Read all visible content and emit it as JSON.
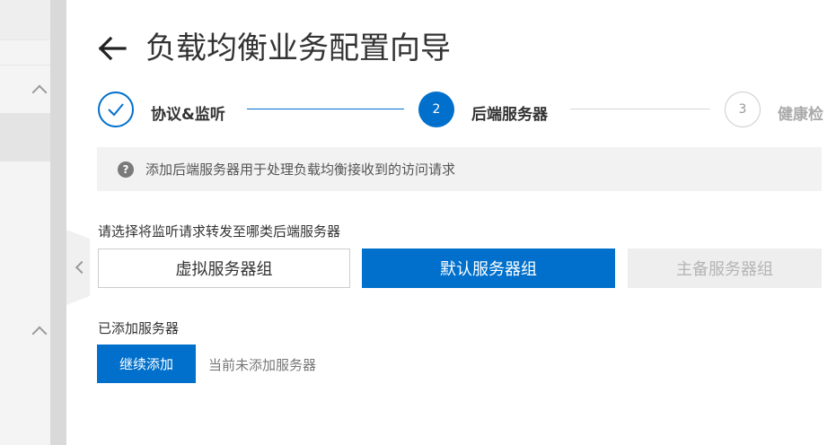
{
  "header": {
    "title": "负载均衡业务配置向导"
  },
  "stepper": {
    "steps": [
      {
        "label": "协议&监听",
        "number": "",
        "state": "completed"
      },
      {
        "label": "后端服务器",
        "number": "2",
        "state": "active"
      },
      {
        "label": "健康检",
        "number": "3",
        "state": "pending"
      }
    ]
  },
  "info": {
    "icon": "question-circle-icon",
    "text": "添加后端服务器用于处理负载均衡接收到的访问请求"
  },
  "server_group": {
    "prompt": "请选择将监听请求转发至哪类后端服务器",
    "options": [
      {
        "label": "虚拟服务器组",
        "state": "unselected"
      },
      {
        "label": "默认服务器组",
        "state": "selected"
      },
      {
        "label": "主备服务器组",
        "state": "disabled"
      }
    ]
  },
  "added_servers": {
    "label": "已添加服务器",
    "continue_button": "继续添加",
    "empty_text": "当前未添加服务器"
  },
  "colors": {
    "primary": "#0070cc",
    "info_background": "#f2f2f2",
    "disabled_background": "#eeeeee"
  }
}
